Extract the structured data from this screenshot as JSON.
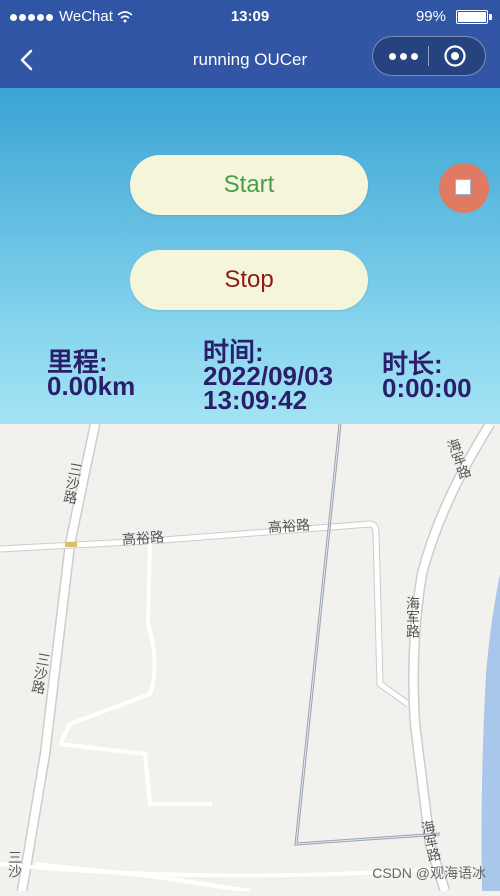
{
  "status_bar": {
    "carrier": "WeChat",
    "time": "13:09",
    "battery_percent": "99%",
    "battery_level": 0.99
  },
  "nav": {
    "title": "running OUCer"
  },
  "controls": {
    "start_label": "Start",
    "stop_label": "Stop"
  },
  "stats": {
    "mileage_label": "里程:",
    "mileage_value": "0.00km",
    "time_label": "时间:",
    "time_date": "2022/09/03",
    "time_clock": "13:09:42",
    "duration_label": "时长:",
    "duration_value": "0:00:00"
  },
  "map": {
    "roads": [
      "三沙路",
      "高裕路",
      "高裕路",
      "三沙路",
      "海军路",
      "海军路",
      "海军路",
      "三沙"
    ]
  },
  "watermark": "CSDN @观海语冰",
  "colors": {
    "nav_bg": "#3355a6",
    "start_text": "#4a9e4a",
    "stop_text": "#8b1a1a",
    "record_button": "#e07a63",
    "stats_text": "#2b1e6b"
  }
}
